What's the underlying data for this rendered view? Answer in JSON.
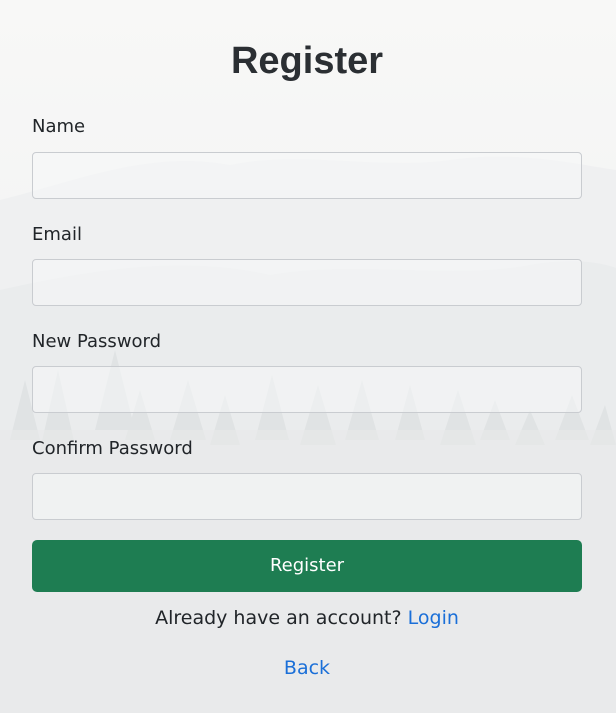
{
  "page": {
    "title": "Register"
  },
  "form": {
    "fields": [
      {
        "label": "Name",
        "value": "",
        "type": "text"
      },
      {
        "label": "Email",
        "value": "",
        "type": "email"
      },
      {
        "label": "New Password",
        "value": "",
        "type": "password"
      },
      {
        "label": "Confirm Password",
        "value": "",
        "type": "password"
      }
    ],
    "submit_label": "Register"
  },
  "footer": {
    "login_prompt": "Already have an account?",
    "login_link": "Login",
    "back_link": "Back"
  },
  "colors": {
    "button_bg": "#1e7d52",
    "link": "#1a6fd8",
    "background": "#f6f6f5"
  }
}
